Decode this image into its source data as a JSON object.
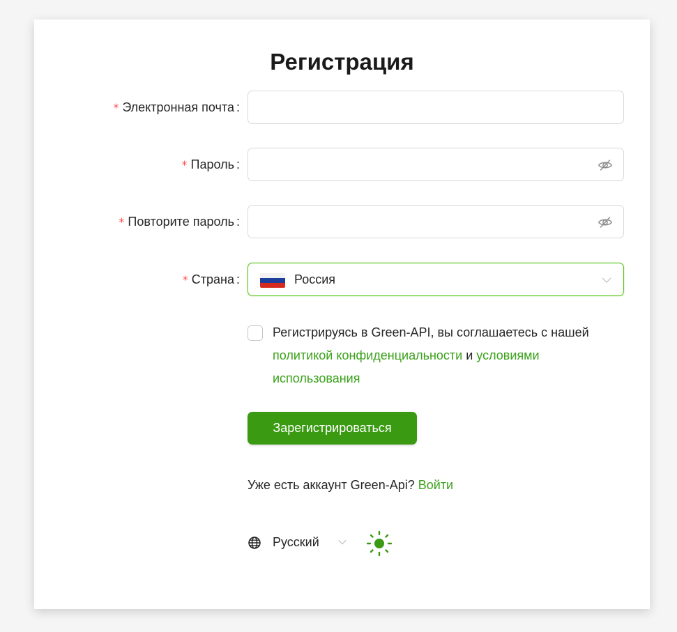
{
  "page": {
    "title": "Регистрация"
  },
  "form": {
    "email": {
      "label": "Электронная почта",
      "value": "",
      "required": "*",
      "colon": ":"
    },
    "password": {
      "label": "Пароль",
      "value": "",
      "required": "*",
      "colon": ":"
    },
    "repeat_password": {
      "label": "Повторите пароль",
      "value": "",
      "required": "*",
      "colon": ":"
    },
    "country": {
      "label": "Страна",
      "value": "Россия",
      "required": "*",
      "colon": ":",
      "flag_icon": "russia-flag-icon"
    }
  },
  "agreement": {
    "checked": false,
    "text_before": "Регистрируясь в Green-API, вы соглашаетесь с нашей ",
    "privacy_link": "политикой конфиденциальности",
    "text_middle": " и ",
    "terms_link": "условиями использования"
  },
  "submit_label": "Зарегистрироваться",
  "login": {
    "prompt": "Уже есть аккаунт Green-Api? ",
    "link": "Войти"
  },
  "footer": {
    "language": "Русский",
    "language_icon": "globe-icon",
    "theme_icon": "sun-icon"
  },
  "colors": {
    "accent": "#3a9a12",
    "link": "#3aa11a",
    "required": "#ff4d4f",
    "focus_border": "#52c41a"
  }
}
